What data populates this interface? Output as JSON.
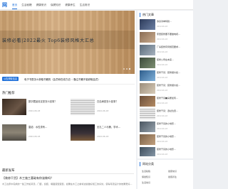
{
  "header": {
    "logo": "网",
    "nav": [
      {
        "label": "首页",
        "active": true
      },
      {
        "label": "生活秘籍",
        "active": false
      },
      {
        "label": "健康常识",
        "active": false
      },
      {
        "label": "保健知识",
        "active": false
      },
      {
        "label": "健康养生",
        "active": false
      },
      {
        "label": "生活常识",
        "active": false
      }
    ]
  },
  "banner": {
    "title": "装修必看|2022最火 Top6装修风格大汇总",
    "slides": 3,
    "active_slide": 2
  },
  "caption": {
    "badge": "公告获取信息",
    "text": "电子书是怎么获取书籍的（会员和在线方法）（备注书籍不能获取会员）"
  },
  "hot": {
    "title": "热门推荐",
    "items": [
      {
        "text": "数字藏品设定是怎么回事？",
        "date": "2022-06-18",
        "thumb": "dark-wood"
      },
      {
        "text": "白血病是怎么回事？",
        "date": "2022-06-18",
        "thumb": "grey-keyboard"
      },
      {
        "text": "雷诺：水性漆有…",
        "date": "2022-06-18",
        "thumb": "sofa"
      },
      {
        "text": "无孔二人马桶，学术…",
        "date": "2022-06-18",
        "thumb": "night-city"
      }
    ]
  },
  "latest": {
    "title": "最新发布",
    "post_title": "【装修干货】木工施工基础有你该做吗？",
    "excerpt": "木工在家中完成的一些工作如吊顶，门套，窗套，墙面造型造型，如果在木工之前将这些做好施工的好处，使得吊顶设计的效果更好…",
    "meta": [
      "2022-06-18",
      "热度",
      "评论"
    ]
  },
  "news": {
    "title": "热门文章",
    "items": [
      {
        "text": "零食清单特别…",
        "date": "2022-06-18"
      },
      {
        "text": "家里装修要不要做电视…",
        "date": "2022-06-18"
      },
      {
        "text": "厂房装修有何规范要求…",
        "date": "2022-06-18"
      },
      {
        "text": "装修公司在本来…",
        "date": "2022-06-18"
      },
      {
        "text": "装修干货：装修报价如…",
        "date": "2022-06-18"
      },
      {
        "text": "装修干货：装修报价如…",
        "date": "2022-06-18"
      },
      {
        "text": "装修干货■房屋如何…",
        "date": "2022-06-18"
      },
      {
        "text": "装修干货：选址位置…",
        "date": "2022-06-18"
      },
      {
        "text": "装修干货的小地形…",
        "date": "2022-06-18"
      },
      {
        "text": "装修干货的小地形…",
        "date": "2022-06-18"
      },
      {
        "text": "装修干货的小地形…",
        "date": "2022-06-18"
      }
    ]
  },
  "links": {
    "title": "网站分类",
    "items": [
      "生活秘籍",
      "健康常识",
      "保健知识",
      "健康养生",
      "生活常识"
    ]
  },
  "colors": {
    "accent": "#1e6fd9"
  }
}
